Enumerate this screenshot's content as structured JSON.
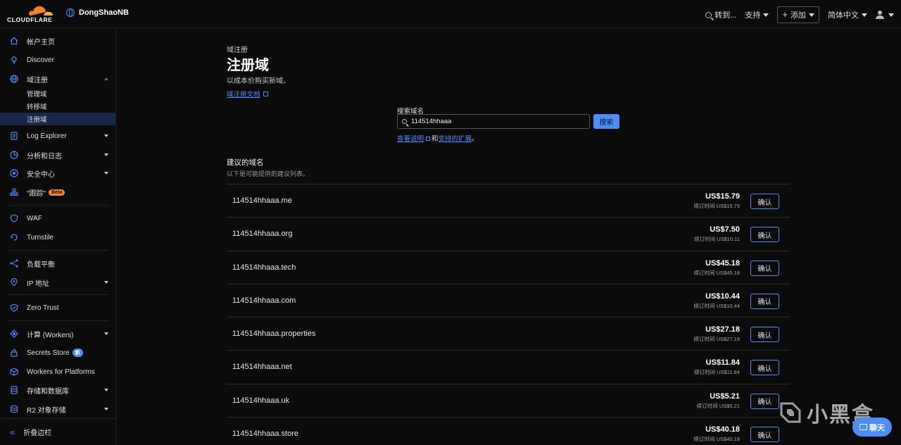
{
  "header": {
    "logo_text": "CLOUDFLARE",
    "account_name": "DongShaoNB",
    "goto_label": "转到...",
    "support_label": "支持",
    "add_label": "添加",
    "language_label": "简体中文"
  },
  "sidebar": {
    "items": [
      {
        "label": "帐户主页"
      },
      {
        "label": "Discover"
      },
      {
        "label": "域注册"
      },
      {
        "label": "管理域"
      },
      {
        "label": "转移域"
      },
      {
        "label": "注册域"
      },
      {
        "label": "Log Explorer"
      },
      {
        "label": "分析和日志"
      },
      {
        "label": "安全中心"
      },
      {
        "label": "\"跟踪\"",
        "badge": "Beta"
      },
      {
        "label": "WAF"
      },
      {
        "label": "Turnstile"
      },
      {
        "label": "负载平衡"
      },
      {
        "label": "IP 地址"
      },
      {
        "label": "Zero Trust"
      },
      {
        "label": "计算 (Workers)"
      },
      {
        "label": "Secrets Store",
        "badge": "新"
      },
      {
        "label": "Workers for Platforms"
      },
      {
        "label": "存储和数据库"
      },
      {
        "label": "R2 对象存储"
      }
    ],
    "collapse_label": "折叠边栏"
  },
  "page": {
    "breadcrumb": "域注册",
    "title": "注册域",
    "description": "以成本价购买新域。",
    "docs_link": "域注册文档"
  },
  "search": {
    "label": "搜索域名",
    "value": "114514hhaaa",
    "button": "搜索",
    "help_link": "查看说明",
    "and_text": "和",
    "ext_link": "支持的扩展",
    "period": "。"
  },
  "suggestions": {
    "heading": "建议的域名",
    "subheading": "以下是可能提供的建议列表。",
    "renew_prefix": "续订时间",
    "confirm_label": "确认",
    "rows": [
      {
        "domain": "114514hhaaa.me",
        "price": "US$15.79",
        "renew": "US$15.79"
      },
      {
        "domain": "114514hhaaa.org",
        "price": "US$7.50",
        "renew": "US$10.11"
      },
      {
        "domain": "114514hhaaa.tech",
        "price": "US$45.18",
        "renew": "US$45.18"
      },
      {
        "domain": "114514hhaaa.com",
        "price": "US$10.44",
        "renew": "US$10.44"
      },
      {
        "domain": "114514hhaaa.properties",
        "price": "US$27.18",
        "renew": "US$27.18"
      },
      {
        "domain": "114514hhaaa.net",
        "price": "US$11.84",
        "renew": "US$11.84"
      },
      {
        "domain": "114514hhaaa.uk",
        "price": "US$5.21",
        "renew": "US$5.21"
      },
      {
        "domain": "114514hhaaa.store",
        "price": "US$40.18",
        "renew": "US$40.18"
      }
    ]
  },
  "watermark": {
    "text": "小黑盒"
  },
  "chat": {
    "label": "聊天"
  },
  "colors": {
    "accent": "#4c8df6",
    "brand_orange": "#f38020",
    "background": "#0b0b0b"
  }
}
